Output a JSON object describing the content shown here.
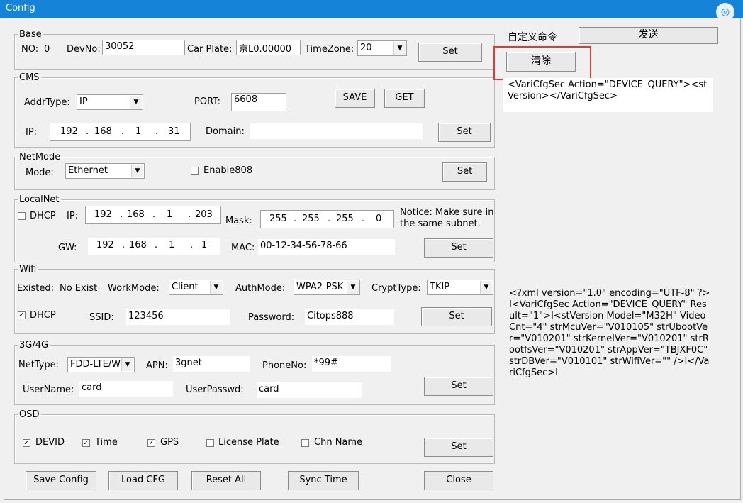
{
  "window": {
    "title": "Config"
  },
  "base": {
    "legend": "Base",
    "no_label": "NO:",
    "no_value": "0",
    "devno_label": "DevNo:",
    "devno_value": "30052",
    "plate_label": "Car Plate:",
    "plate_value": "京L0.00000",
    "tz_label": "TimeZone:",
    "tz_value": "20",
    "set": "Set"
  },
  "cms": {
    "legend": "CMS",
    "addrtype_label": "AddrType:",
    "addrtype_value": "IP",
    "port_label": "PORT:",
    "port_value": "6608",
    "save": "SAVE",
    "get": "GET",
    "ip_label": "IP:",
    "ip": [
      "192",
      "168",
      "1",
      "31"
    ],
    "domain_label": "Domain:",
    "domain_value": "",
    "set": "Set"
  },
  "netmode": {
    "legend": "NetMode",
    "mode_label": "Mode:",
    "mode_value": "Ethernet",
    "enable808": "Enable808",
    "set": "Set"
  },
  "localnet": {
    "legend": "LocalNet",
    "dhcp": "DHCP",
    "ip_label": "IP:",
    "ip": [
      "192",
      "168",
      "1",
      "203"
    ],
    "mask_label": "Mask:",
    "mask": [
      "255",
      "255",
      "255",
      "0"
    ],
    "notice": "Notice: Make sure in the same subnet.",
    "gw_label": "GW:",
    "gw": [
      "192",
      "168",
      "1",
      "1"
    ],
    "mac_label": "MAC:",
    "mac_value": "00-12-34-56-78-66",
    "set": "Set"
  },
  "wifi": {
    "legend": "Wifi",
    "existed_label": "Existed:",
    "existed_value": "No Exist",
    "workmode_label": "WorkMode:",
    "workmode_value": "Client",
    "authmode_label": "AuthMode:",
    "authmode_value": "WPA2-PSK",
    "crypt_label": "CryptType:",
    "crypt_value": "TKIP",
    "dhcp": "DHCP",
    "ssid_label": "SSID:",
    "ssid_value": "123456",
    "pwd_label": "Password:",
    "pwd_value": "Citops888",
    "set": "Set"
  },
  "g34": {
    "legend": "3G/4G",
    "nettype_label": "NetType:",
    "nettype_value": "FDD-LTE/W",
    "apn_label": "APN:",
    "apn_value": "3gnet",
    "phone_label": "PhoneNo:",
    "phone_value": "*99#",
    "user_label": "UserName:",
    "user_value": "card",
    "pwd_label": "UserPasswd:",
    "pwd_value": "card",
    "set": "Set"
  },
  "osd": {
    "legend": "OSD",
    "devid": "DEVID",
    "time": "Time",
    "gps": "GPS",
    "plate": "License Plate",
    "chn": "Chn Name",
    "set": "Set"
  },
  "bottom": {
    "save_config": "Save Config",
    "load_cfg": "Load CFG",
    "reset_all": "Reset All",
    "sync_time": "Sync Time",
    "close": "Close"
  },
  "right": {
    "custom_cmd_label": "自定义命令",
    "send": "发送",
    "clear": "清除",
    "command_text": "<VariCfgSec Action=\"DEVICE_QUERY\"><stVersion></VariCfgSec>",
    "response_text": "<?xml version=\"1.0\" encoding=\"UTF-8\" ?>I<VariCfgSec Action=\"DEVICE_QUERY\" Result=\"1\">I<stVersion Model=\"M32H\" VideoCnt=\"4\" strMcuVer=\"V010105\" strUbootVer=\"V010201\" strKernelVer=\"V010201\" strRootfsVer=\"V010201\" strAppVer=\"TBJXF0C\" strDBVer=\"V010101\" strWifiVer=\"\" />I</VariCfgSec>I"
  }
}
